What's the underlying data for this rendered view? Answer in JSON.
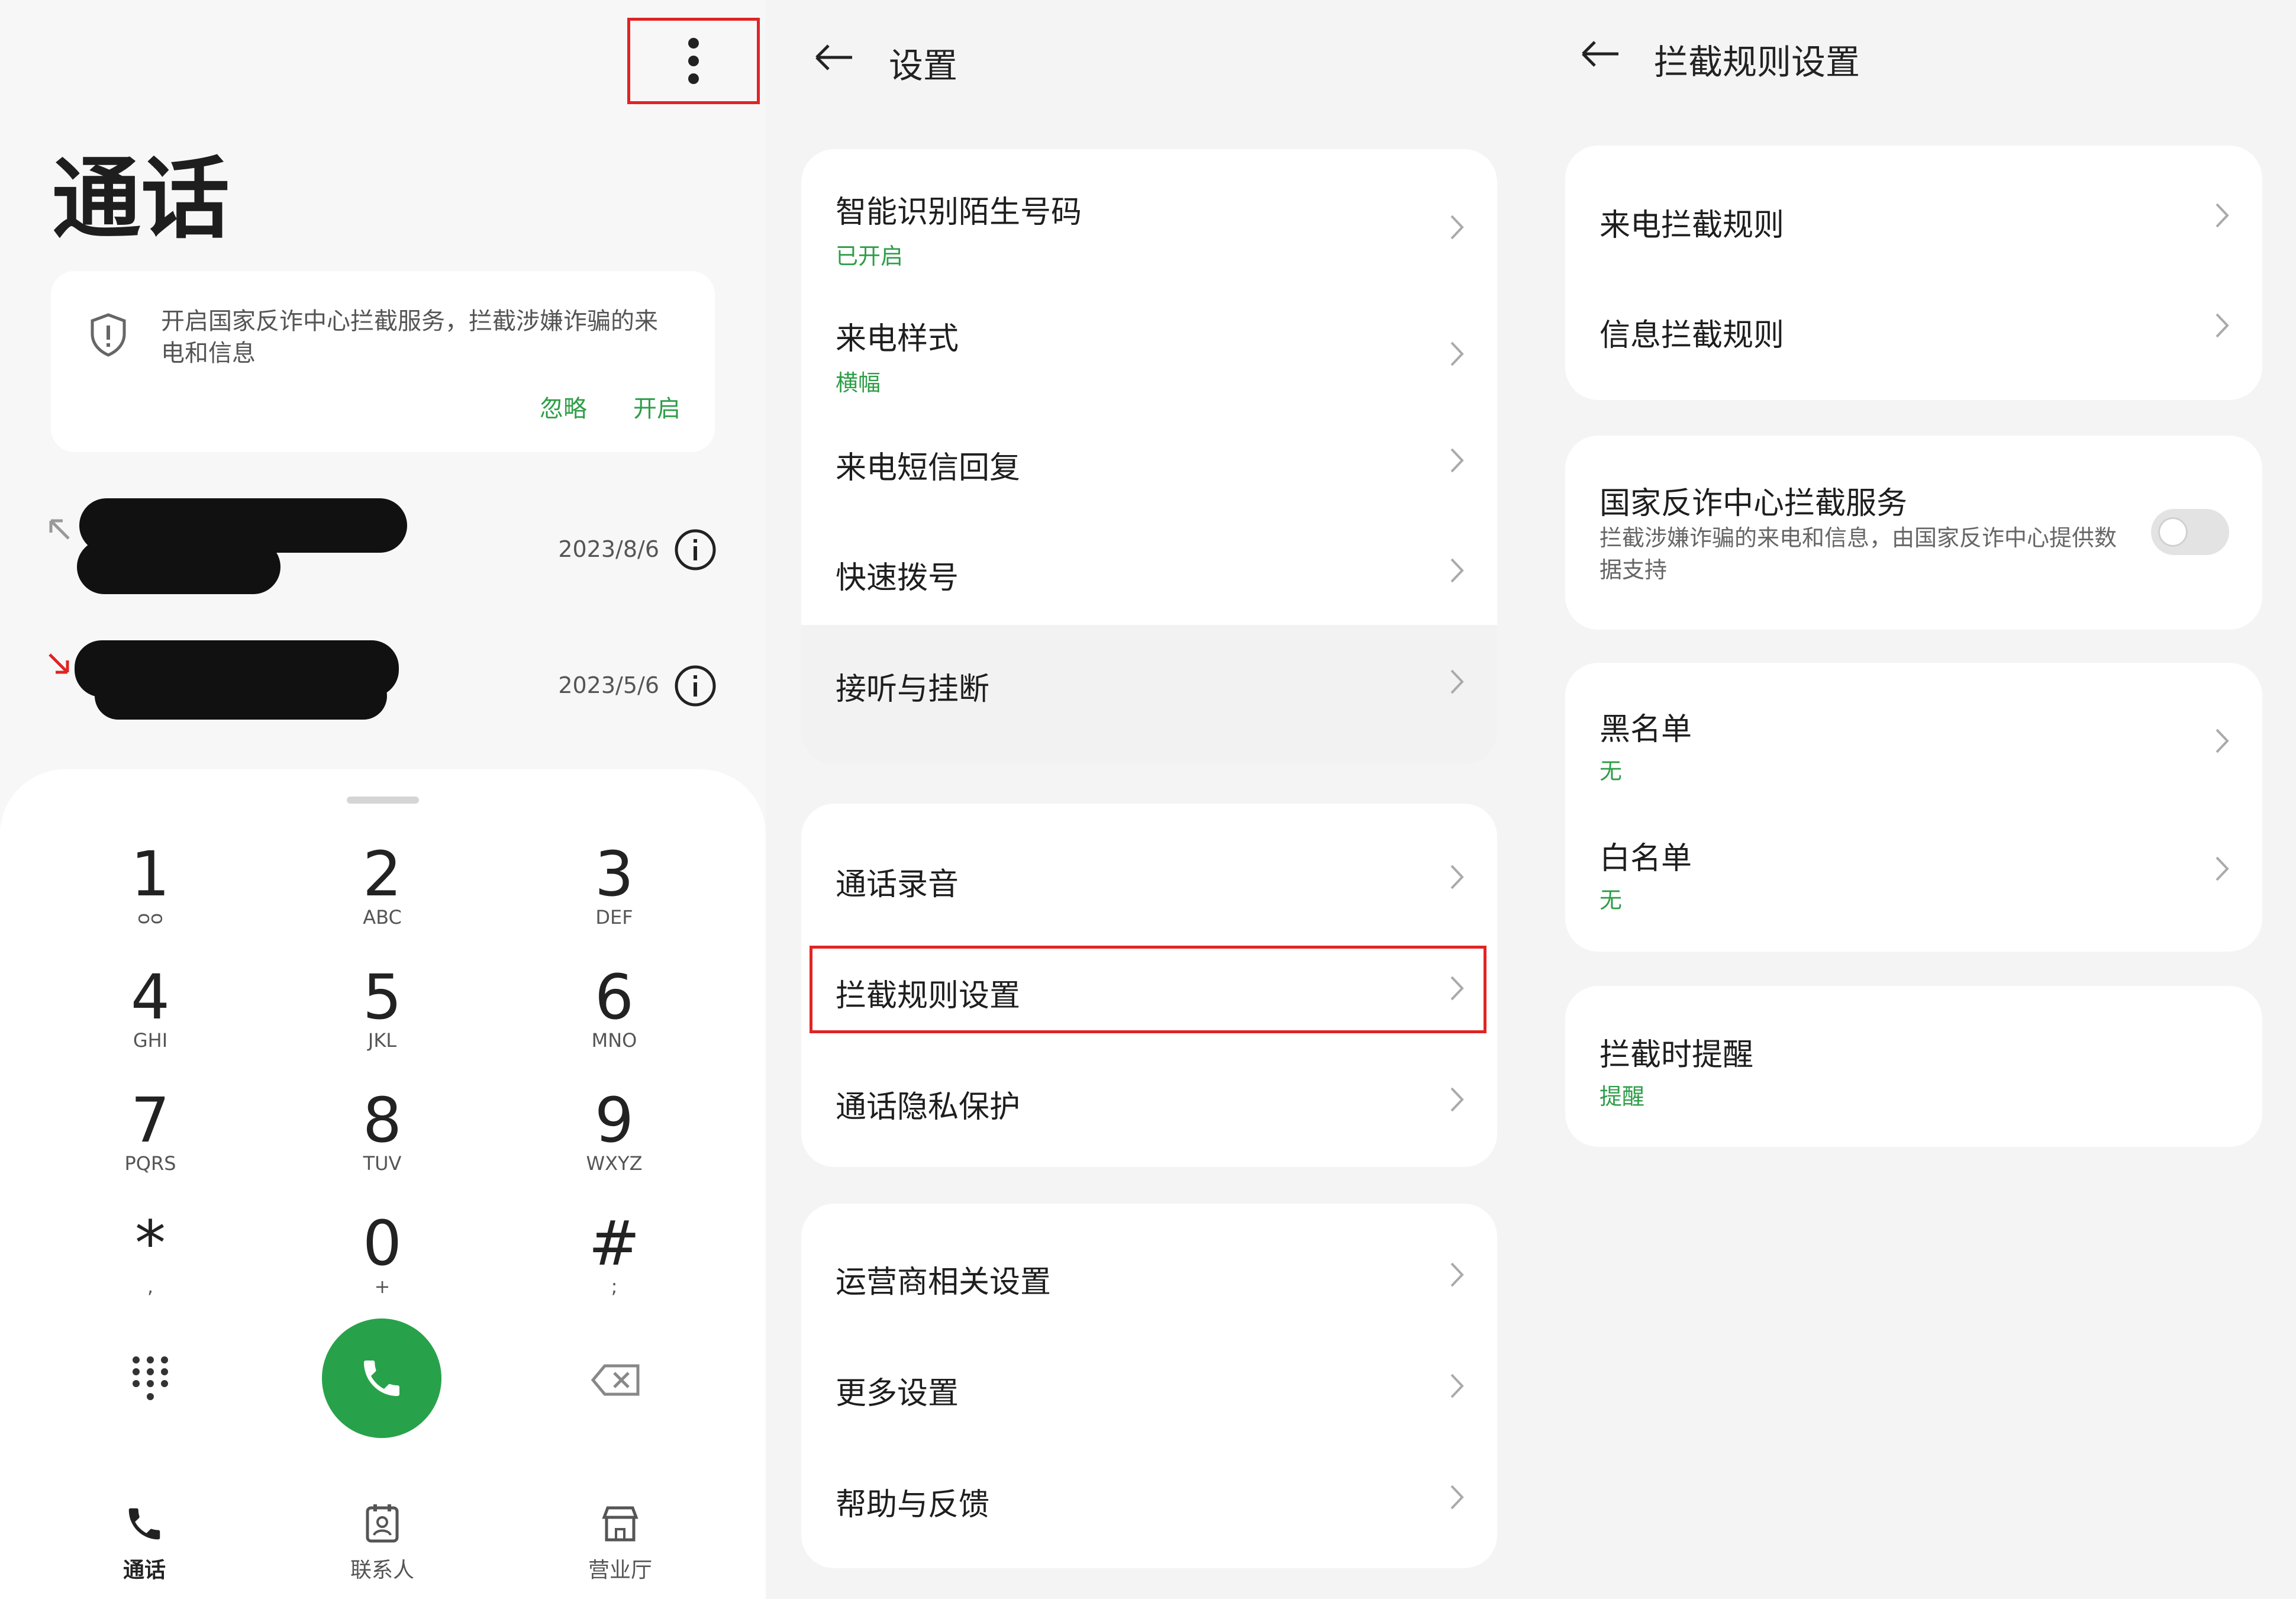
{
  "panel1": {
    "title": "通话",
    "notice": {
      "text": "开启国家反诈中心拦截服务，拦截涉嫌诈骗的来电和信息",
      "ignore": "忽略",
      "enable": "开启"
    },
    "calls": [
      {
        "direction": "outgoing",
        "date": "2023/8/6"
      },
      {
        "direction": "missed",
        "date": "2023/5/6"
      }
    ],
    "keypad": [
      {
        "digit": "1",
        "sub": "ᴑᴑ"
      },
      {
        "digit": "2",
        "sub": "ABC"
      },
      {
        "digit": "3",
        "sub": "DEF"
      },
      {
        "digit": "4",
        "sub": "GHI"
      },
      {
        "digit": "5",
        "sub": "JKL"
      },
      {
        "digit": "6",
        "sub": "MNO"
      },
      {
        "digit": "7",
        "sub": "PQRS"
      },
      {
        "digit": "8",
        "sub": "TUV"
      },
      {
        "digit": "9",
        "sub": "WXYZ"
      },
      {
        "digit": "*",
        "sub": ","
      },
      {
        "digit": "0",
        "sub": "+"
      },
      {
        "digit": "#",
        "sub": ";"
      }
    ],
    "tabs": [
      {
        "label": "通话",
        "icon": "phone-icon",
        "active": true
      },
      {
        "label": "联系人",
        "icon": "contacts-icon",
        "active": false
      },
      {
        "label": "营业厅",
        "icon": "store-icon",
        "active": false
      }
    ],
    "colors": {
      "accent": "#27a24a",
      "highlight": "#e02424",
      "missed": "#e02424"
    }
  },
  "panel2": {
    "title": "设置",
    "groups": [
      [
        {
          "label": "智能识别陌生号码",
          "sub": "已开启"
        },
        {
          "label": "来电样式",
          "sub": "横幅"
        },
        {
          "label": "来电短信回复",
          "sub": ""
        },
        {
          "label": "快速拨号",
          "sub": ""
        },
        {
          "label": "接听与挂断",
          "sub": ""
        }
      ],
      [
        {
          "label": "通话录音",
          "sub": ""
        },
        {
          "label": "拦截规则设置",
          "sub": ""
        },
        {
          "label": "通话隐私保护",
          "sub": ""
        }
      ],
      [
        {
          "label": "运营商相关设置",
          "sub": ""
        },
        {
          "label": "更多设置",
          "sub": ""
        },
        {
          "label": "帮助与反馈",
          "sub": ""
        }
      ]
    ]
  },
  "panel3": {
    "title": "拦截规则设置",
    "rules": [
      {
        "label": "来电拦截规则"
      },
      {
        "label": "信息拦截规则"
      }
    ],
    "antifraud": {
      "label": "国家反诈中心拦截服务",
      "desc": "拦截涉嫌诈骗的来电和信息，由国家反诈中心提供数据支持",
      "enabled": false
    },
    "lists": [
      {
        "label": "黑名单",
        "sub": "无"
      },
      {
        "label": "白名单",
        "sub": "无"
      }
    ],
    "reminder": {
      "label": "拦截时提醒",
      "sub": "提醒"
    }
  }
}
